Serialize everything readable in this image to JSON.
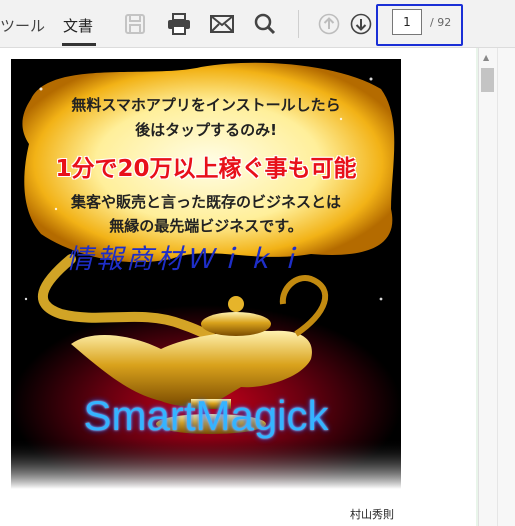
{
  "toolbar": {
    "tools_tab": "ツール",
    "document_tab": "文書",
    "save_icon": "save-icon",
    "print_icon": "print-icon",
    "mail_icon": "mail-icon",
    "search_icon": "search-icon",
    "prev_icon": "arrow-up-icon",
    "next_icon": "arrow-down-icon",
    "current_page": "1",
    "total_pages": "/ 92"
  },
  "cover": {
    "line1": "無料スマホアプリをインストールしたら",
    "line2": "後はタップするのみ!",
    "headline": "1分で20万以上稼ぐ事も可能",
    "line3": "集客や販売と言った既存のビジネスとは",
    "line4": "無縁の最先端ビジネスです。",
    "watermark": "情報商材Ｗｉｋｉ",
    "product": "SmartMagick"
  },
  "author": "村山秀則",
  "colors": {
    "highlight_border": "#1a2fd6",
    "viewer_background": "#e9f5ea",
    "headline_red": "#e8101a",
    "product_blue": "#35b4ff"
  }
}
